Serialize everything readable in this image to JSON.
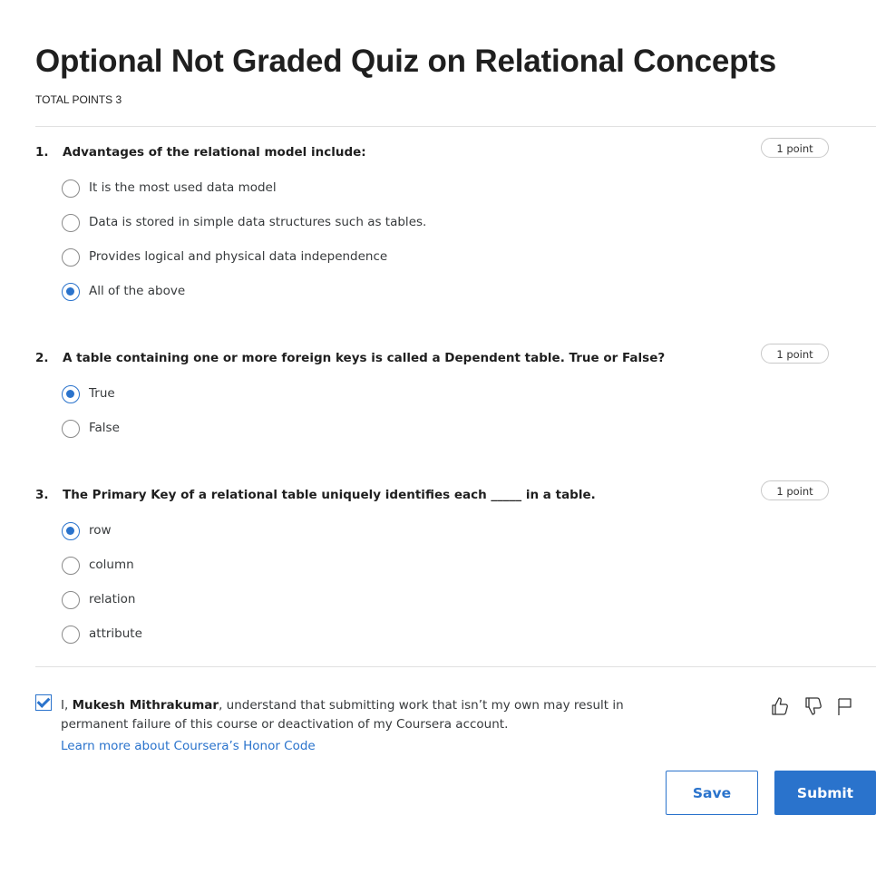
{
  "page": {
    "title": "Optional Not Graded Quiz on Relational Concepts",
    "total_points": "TOTAL POINTS 3"
  },
  "questions": [
    {
      "number": "1.",
      "text": "Advantages of the relational model include:",
      "points": "1 point",
      "options": [
        {
          "label": "It is the most used data model",
          "selected": false
        },
        {
          "label": "Data is stored in simple data structures such as tables.",
          "selected": false
        },
        {
          "label": "Provides logical and physical data independence",
          "selected": false
        },
        {
          "label": "All of the above",
          "selected": true
        }
      ]
    },
    {
      "number": "2.",
      "text": "A table containing one or more foreign keys is called a Dependent table. True or False?",
      "points": "1 point",
      "options": [
        {
          "label": "True",
          "selected": true
        },
        {
          "label": "False",
          "selected": false
        }
      ]
    },
    {
      "number": "3.",
      "text": "The Primary Key of a relational table uniquely identifies each _____ in a table.",
      "points": "1 point",
      "options": [
        {
          "label": "row",
          "selected": true
        },
        {
          "label": "column",
          "selected": false
        },
        {
          "label": "relation",
          "selected": false
        },
        {
          "label": "attribute",
          "selected": false
        }
      ]
    }
  ],
  "honor": {
    "checked": true,
    "prefix": "I, ",
    "name": "Mukesh Mithrakumar",
    "suffix": ", understand that submitting work that isn’t my own may result in permanent failure of this course or deactivation of my Coursera account.",
    "link": "Learn more about Coursera’s Honor Code"
  },
  "feedback_icons": [
    "thumbs-up-icon",
    "thumbs-down-icon",
    "flag-icon"
  ],
  "buttons": {
    "save": "Save",
    "submit": "Submit"
  },
  "colors": {
    "accent": "#2a73cc",
    "text": "#1f1f1f",
    "divider": "#e1e1e1"
  }
}
